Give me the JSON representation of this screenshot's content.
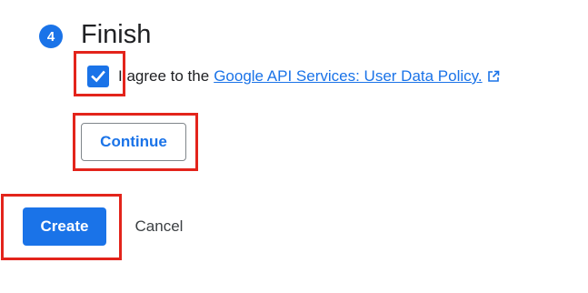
{
  "step": {
    "number": "4",
    "title": "Finish"
  },
  "agreement": {
    "checked": true,
    "text": "I agree to the",
    "link_text": "Google API Services: User Data Policy."
  },
  "buttons": {
    "continue": "Continue",
    "create": "Create",
    "cancel": "Cancel"
  },
  "colors": {
    "accent": "#1a73e8",
    "highlight": "#e3241b"
  },
  "icons": {
    "checkbox": "checkmark-icon",
    "link": "external-link-icon"
  }
}
